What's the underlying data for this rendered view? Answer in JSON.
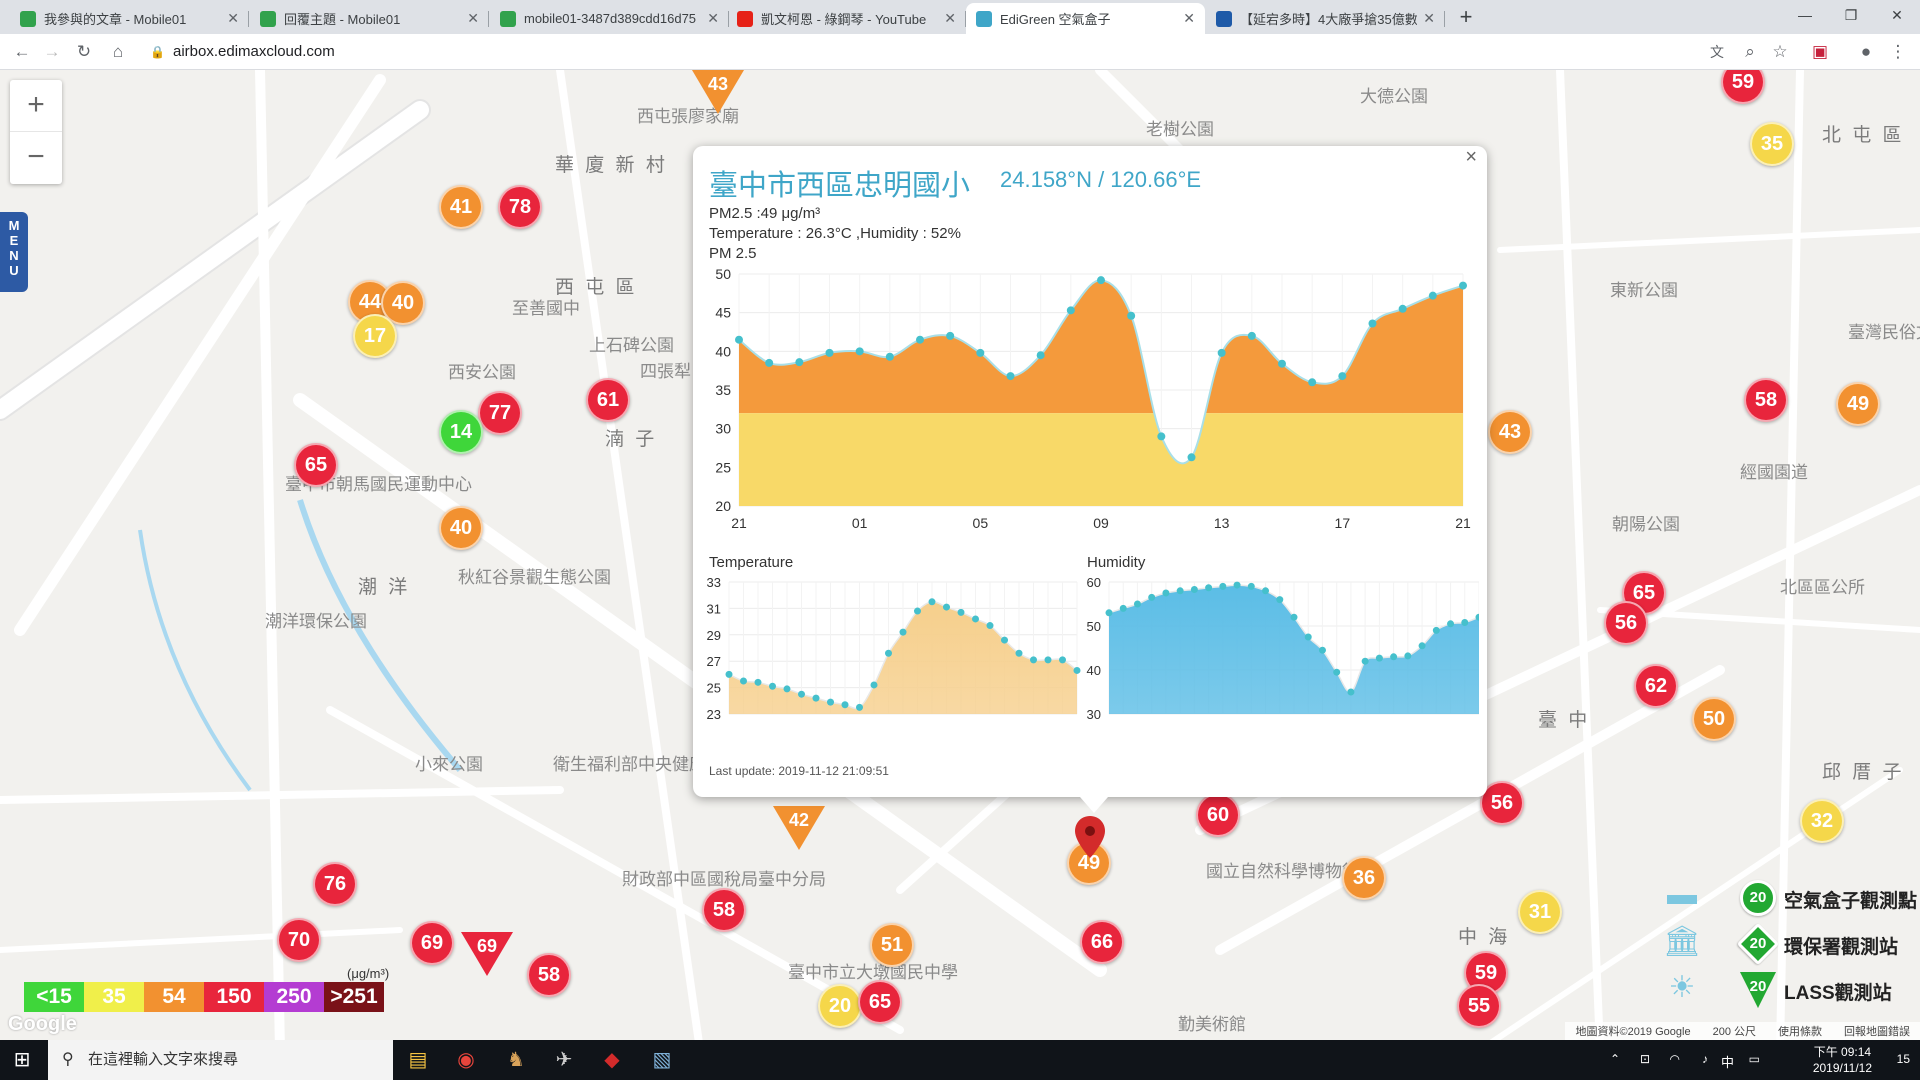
{
  "browser": {
    "tabs": [
      {
        "title": "我參與的文章 - Mobile01",
        "icon": "mobile01-icon",
        "active": false
      },
      {
        "title": "回覆主題 - Mobile01",
        "icon": "mobile01-icon",
        "active": false
      },
      {
        "title": "mobile01-3487d389cdd16d75",
        "icon": "mobile01-icon",
        "active": false
      },
      {
        "title": "凱文柯恩 - 綠鋼琴 - YouTube",
        "icon": "youtube-icon",
        "active": false
      },
      {
        "title": "EdiGreen 空氣盒子",
        "icon": "edigreen-icon",
        "active": true
      },
      {
        "title": "【延宕多時】4大廠爭搶35億數",
        "icon": "news-icon",
        "active": false
      }
    ],
    "new_tab": "+",
    "url": "airbox.edimaxcloud.com"
  },
  "map": {
    "zoom_in": "+",
    "zoom_out": "−",
    "menu_label": "MENU",
    "labels": [
      {
        "text": "華 廈 新 村",
        "big": true
      },
      {
        "text": "西 屯 區",
        "big": true
      },
      {
        "text": "潮 洋",
        "big": true
      },
      {
        "text": "北 屯 區",
        "big": true
      },
      {
        "text": "邱 厝 子",
        "big": true
      },
      {
        "text": "臺 中",
        "big": true
      },
      {
        "text": "中 海",
        "big": true
      },
      {
        "text": "湳 子",
        "big": true
      },
      {
        "text": "老樹公園"
      },
      {
        "text": "大德公園"
      },
      {
        "text": "西安公園"
      },
      {
        "text": "臺中市朝馬國民運動中心"
      },
      {
        "text": "秋紅谷景觀生態公園"
      },
      {
        "text": "潮洋環保公園"
      },
      {
        "text": "小來公園"
      },
      {
        "text": "衛生福利部中央健康保險署中區業務組"
      },
      {
        "text": "財政部中區國稅局臺中分局"
      },
      {
        "text": "國立自然科學博物館"
      },
      {
        "text": "臺中市立大墩國民中學"
      },
      {
        "text": "東新公園"
      },
      {
        "text": "朝陽公園"
      },
      {
        "text": "北區區公所"
      },
      {
        "text": "經國園道"
      },
      {
        "text": "勤美術館"
      },
      {
        "text": "臺灣民俗文物館"
      },
      {
        "text": "至善國中"
      },
      {
        "text": "上石碑公園"
      },
      {
        "text": "四張犁"
      },
      {
        "text": "西屯張廖家廟"
      }
    ],
    "markers": [
      {
        "value": "59",
        "color": "red"
      },
      {
        "value": "35",
        "color": "yellow"
      },
      {
        "value": "43",
        "color": "orange",
        "shape": "triangle"
      },
      {
        "value": "41",
        "color": "orange"
      },
      {
        "value": "78",
        "color": "red"
      },
      {
        "value": "44",
        "color": "orange"
      },
      {
        "value": "40",
        "color": "orange"
      },
      {
        "value": "17",
        "color": "yellow"
      },
      {
        "value": "77",
        "color": "red"
      },
      {
        "value": "14",
        "color": "green"
      },
      {
        "value": "61",
        "color": "red"
      },
      {
        "value": "65",
        "color": "red"
      },
      {
        "value": "40",
        "color": "orange"
      },
      {
        "value": "43",
        "color": "orange"
      },
      {
        "value": "58",
        "color": "red"
      },
      {
        "value": "49",
        "color": "orange"
      },
      {
        "value": "65",
        "color": "red"
      },
      {
        "value": "56",
        "color": "red"
      },
      {
        "value": "62",
        "color": "red"
      },
      {
        "value": "50",
        "color": "orange"
      },
      {
        "value": "32",
        "color": "yellow"
      },
      {
        "value": "56",
        "color": "red"
      },
      {
        "value": "60",
        "color": "red"
      },
      {
        "value": "42",
        "color": "orange",
        "shape": "triangle"
      },
      {
        "value": "49",
        "color": "orange"
      },
      {
        "value": "36",
        "color": "orange"
      },
      {
        "value": "31",
        "color": "yellow"
      },
      {
        "value": "76",
        "color": "red"
      },
      {
        "value": "70",
        "color": "red"
      },
      {
        "value": "69",
        "color": "red"
      },
      {
        "value": "69",
        "color": "red",
        "shape": "triangle"
      },
      {
        "value": "58",
        "color": "red"
      },
      {
        "value": "58",
        "color": "red"
      },
      {
        "value": "51",
        "color": "orange"
      },
      {
        "value": "66",
        "color": "red"
      },
      {
        "value": "20",
        "color": "yellow"
      },
      {
        "value": "65",
        "color": "red"
      },
      {
        "value": "59",
        "color": "red"
      },
      {
        "value": "55",
        "color": "red"
      }
    ],
    "aqi_legend": [
      {
        "label": "<15",
        "color": "#3fd63a"
      },
      {
        "label": "35",
        "color": "#f0ef4a"
      },
      {
        "label": "54",
        "color": "#f29130"
      },
      {
        "label": "150",
        "color": "#e8253c"
      },
      {
        "label": "250",
        "color": "#b43cd2"
      },
      {
        "label": ">251",
        "color": "#7a1218"
      }
    ],
    "aqi_unit": "(μg/m³)",
    "type_legend": [
      {
        "label": "空氣盒子觀測點",
        "value": "20",
        "icon": "airbox-icon"
      },
      {
        "label": "環保署觀測站",
        "value": "20",
        "icon": "epa-station-icon"
      },
      {
        "label": "LASS觀測站",
        "value": "20",
        "icon": "lass-station-icon"
      }
    ],
    "footer": {
      "data": "地圖資料©2019 Google",
      "scale": "200 公尺",
      "terms": "使用條款",
      "report": "回報地圖錯誤"
    },
    "google_logo": "Google"
  },
  "popup": {
    "title": "臺中市西區忠明國小",
    "coords": "24.158°N / 120.66°E",
    "pm25_line": "PM2.5 :49 μg/m³",
    "th_line": "Temperature : 26.3°C ,Humidity : 52%",
    "chart_title": "PM 2.5",
    "temp_title": "Temperature",
    "hum_title": "Humidity",
    "last_update": "Last update: 2019-11-12 21:09:51",
    "close": "×"
  },
  "chart_data": [
    {
      "type": "area",
      "title": "PM 2.5",
      "x_ticks": [
        "21",
        "01",
        "05",
        "09",
        "13",
        "17",
        "21"
      ],
      "ylim": [
        20,
        50
      ],
      "y_ticks": [
        20,
        25,
        30,
        35,
        40,
        45,
        50
      ],
      "values": [
        41.5,
        38.5,
        38.6,
        39.8,
        40,
        39.3,
        41.5,
        42,
        39.8,
        36.8,
        39.5,
        45.3,
        49.2,
        44.6,
        29,
        26.3,
        39.8,
        42,
        38.4,
        36,
        36.8,
        43.6,
        45.5,
        47.2,
        48.5
      ],
      "colors": {
        "above": "#f49a3c",
        "band": "#f8d968",
        "line": "#a8dfe8",
        "point": "#45c0cc"
      }
    },
    {
      "type": "area",
      "title": "Temperature",
      "ylim": [
        23,
        33
      ],
      "y_ticks": [
        23,
        25,
        27,
        29,
        31,
        33
      ],
      "values": [
        26,
        25.5,
        25.4,
        25.1,
        24.9,
        24.5,
        24.2,
        23.9,
        23.7,
        23.5,
        25.2,
        27.6,
        29.2,
        30.8,
        31.5,
        31.1,
        30.7,
        30.2,
        29.7,
        28.6,
        27.6,
        27.1,
        27.1,
        27.1,
        26.3
      ],
      "colors": {
        "fill": "#f6cf8c",
        "point": "#45c0cc"
      }
    },
    {
      "type": "area",
      "title": "Humidity",
      "ylim": [
        30,
        60
      ],
      "y_ticks": [
        30,
        40,
        50,
        60
      ],
      "values": [
        53,
        54,
        55,
        56.5,
        57.5,
        58,
        58.3,
        58.7,
        59,
        59.3,
        59,
        58,
        56,
        52,
        47.5,
        44.5,
        39.5,
        35,
        42,
        42.7,
        43,
        43.2,
        45.5,
        49,
        50.5,
        50.8,
        52
      ],
      "colors": {
        "fill": "#5bbde6",
        "point": "#45c0cc"
      }
    }
  ],
  "taskbar": {
    "search_placeholder": "在這裡輸入文字來搜尋",
    "time": "下午 09:14",
    "date": "2019/11/12",
    "ime": "中",
    "notif_count": "15"
  }
}
